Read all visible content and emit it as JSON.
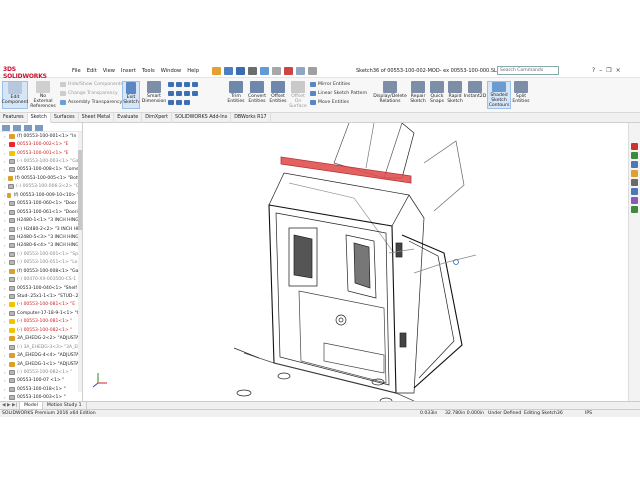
{
  "app": {
    "logo": "3DS SOLIDWORKS",
    "document_title": "Sketch36 of 00553-100-002-MOD- ex 00553-100-000.SLDASM *",
    "search_placeholder": "Search Commands"
  },
  "menu": [
    "File",
    "Edit",
    "View",
    "Insert",
    "Tools",
    "Window",
    "Help"
  ],
  "ribbon": {
    "edit_component": "Edit Component",
    "no_external_refs": "No External References",
    "hide_show": "Hide/Show Components",
    "change_transparency": "Change Transparency",
    "assembly_transparency": "Assembly Transparency",
    "exit_sketch": "Exit Sketch",
    "smart_dimension": "Smart Dimension",
    "trim_entities": "Trim Entities",
    "convert_entities": "Convert Entities",
    "offset_entities": "Offset Entities",
    "offset_on_surface": "Offset On Surface",
    "mirror_entities": "Mirror Entities",
    "linear_sketch_pattern": "Linear Sketch Pattern",
    "move_entities": "Move Entities",
    "display_delete_relations": "Display/Delete Relations",
    "repair_sketch": "Repair Sketch",
    "quick_snaps": "Quick Snaps",
    "rapid_sketch": "Rapid Sketch",
    "instant2d": "Instant2D",
    "shaded_sketch_contours": "Shaded Sketch Contours",
    "split_entities": "Split Entities"
  },
  "tabs": [
    "Features",
    "Sketch",
    "Surfaces",
    "Sheet Metal",
    "Evaluate",
    "DimXpert",
    "SOLIDWORKS Add-Ins",
    "DBWorks R17"
  ],
  "active_tab": "Sketch",
  "tree": [
    {
      "text": "(f) 00553-100-001<1> \"In",
      "icon": "asm",
      "style": ""
    },
    {
      "text": "00553-100-002<1> \"E",
      "icon": "err",
      "style": "red"
    },
    {
      "text": "00553-100-001<1> \"E",
      "icon": "warn",
      "style": "red"
    },
    {
      "text": "(-) 00553-100-003<1> \"Ga",
      "icon": "prt",
      "style": "grey"
    },
    {
      "text": "00553-100-008<1> \"Corne",
      "icon": "prt",
      "style": ""
    },
    {
      "text": "(f) 00553-100-005<1> \"Botto",
      "icon": "asm",
      "style": ""
    },
    {
      "text": "(-) 00553-100-006-2<2> \"Ga",
      "icon": "prt",
      "style": "grey"
    },
    {
      "text": "(f) 00553-100-009-10<10> \"Ir",
      "icon": "asm",
      "style": ""
    },
    {
      "text": "00553-100-060<1> \"Door",
      "icon": "prt",
      "style": ""
    },
    {
      "text": "00553-100-061<1> \"Doori",
      "icon": "prt",
      "style": ""
    },
    {
      "text": "H2480-1<1> \"3 INCH HINGI",
      "icon": "prt",
      "style": ""
    },
    {
      "text": "(-) H2480-2<2> \"3 INCH HI",
      "icon": "prt",
      "style": ""
    },
    {
      "text": "H2480-5<3> \"3 INCH HINGI",
      "icon": "prt",
      "style": ""
    },
    {
      "text": "H2480-6<4> \"3 INCH HINGI",
      "icon": "prt",
      "style": ""
    },
    {
      "text": "(-) 00553-100-001<1> \"Spa",
      "icon": "prt",
      "style": "grey"
    },
    {
      "text": "(-) 00553-100-051<1> \"Le",
      "icon": "prt",
      "style": "grey"
    },
    {
      "text": "(f) 00553-100-008<1> \"Ga",
      "icon": "asm",
      "style": ""
    },
    {
      "text": "(-) 00470-XX-003500-CS-1",
      "icon": "prt",
      "style": "grey"
    },
    {
      "text": "00553-100-040<1> \"Shelf",
      "icon": "prt",
      "style": ""
    },
    {
      "text": "Stud-.25x1-1<1> \"STUD-.25",
      "icon": "prt",
      "style": ""
    },
    {
      "text": "(-) 00553-100-081<1> \"E",
      "icon": "warn",
      "style": "red"
    },
    {
      "text": "Computer-17-18-9-1<1> \"C",
      "icon": "prt",
      "style": ""
    },
    {
      "text": "(-) 00553-100-081<1> \"",
      "icon": "warn",
      "style": "red"
    },
    {
      "text": "(-) 00553-100-082<1> \"",
      "icon": "warn",
      "style": "red"
    },
    {
      "text": "3A_EHEDG-2<2> \"ADJUSTA",
      "icon": "asm",
      "style": ""
    },
    {
      "text": "(-) 3A_EHEDG-3<3> \"3A_EH",
      "icon": "prt",
      "style": "grey"
    },
    {
      "text": "3A_EHEDG-4<4> \"ADJUSTA",
      "icon": "asm",
      "style": ""
    },
    {
      "text": "3A_EHEDG-1<1> \"ADJUSTA",
      "icon": "asm",
      "style": ""
    },
    {
      "text": "(-) 00553-100-082<1> \"",
      "icon": "prt",
      "style": "grey"
    },
    {
      "text": "00553-100-07 <1> \"",
      "icon": "prt",
      "style": ""
    },
    {
      "text": "00553-100-018<1> \"",
      "icon": "prt",
      "style": ""
    },
    {
      "text": "00553-100-003<1> \"",
      "icon": "prt",
      "style": ""
    }
  ],
  "bottom_tabs": [
    "Model",
    "Motion Study 1"
  ],
  "status": {
    "edition": "SOLIDWORKS Premium 2016 x64 Edition",
    "coord1": "0.033in",
    "coord2": "32.780in 0.000in",
    "definition": "Under Defined",
    "editing": "Editing Sketch36",
    "units": "IPS"
  }
}
